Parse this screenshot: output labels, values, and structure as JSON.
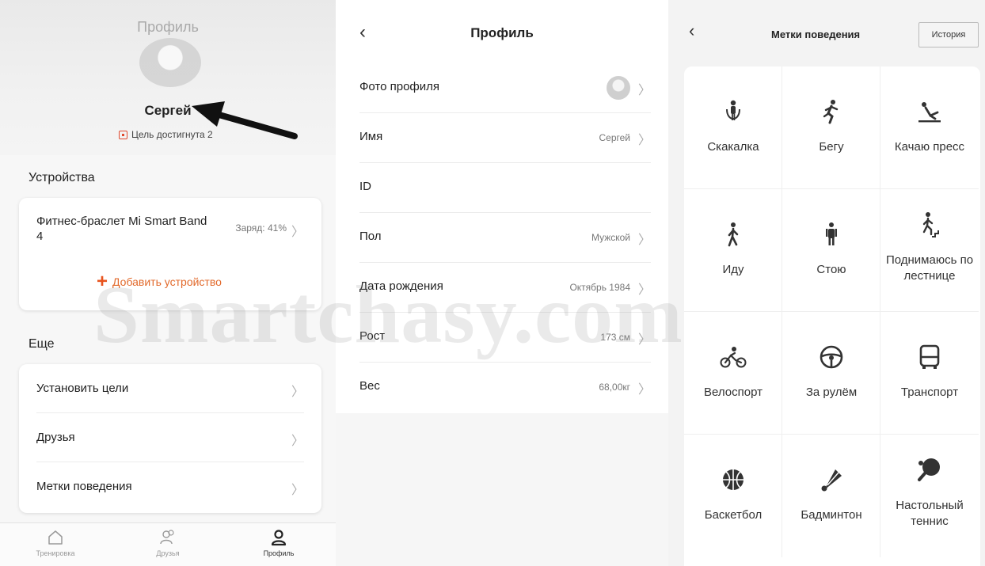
{
  "left": {
    "header": {
      "title": "Профиль",
      "user_name": "Сергей",
      "goal_text": "Цель достигнута 2"
    },
    "devices": {
      "title": "Устройства",
      "device_name": "Фитнес-браслет Mi Smart Band 4",
      "charge": "Заряд: 41%",
      "add_label": "Добавить устройство"
    },
    "more": {
      "title": "Еще",
      "items": [
        {
          "label": "Установить цели"
        },
        {
          "label": "Друзья"
        },
        {
          "label": "Метки поведения"
        }
      ]
    },
    "tabbar": {
      "items": [
        {
          "label": "Тренировка",
          "icon": "home-icon"
        },
        {
          "label": "Друзья",
          "icon": "friends-icon"
        },
        {
          "label": "Профиль",
          "icon": "profile-icon"
        }
      ]
    }
  },
  "middle": {
    "title": "Профиль",
    "rows": [
      {
        "label": "Фото профиля",
        "value": ""
      },
      {
        "label": "Имя",
        "value": "Сергей"
      },
      {
        "label": "ID",
        "value": ""
      },
      {
        "label": "Пол",
        "value": "Мужской"
      },
      {
        "label": "Дата рождения",
        "value": "Октябрь 1984"
      },
      {
        "label": "Рост",
        "value": "173 см"
      },
      {
        "label": "Вес",
        "value": "68,00кг"
      }
    ]
  },
  "right": {
    "title": "Метки поведения",
    "history_label": "История",
    "activities": [
      {
        "label": "Скакалка",
        "icon": "jump-rope-icon"
      },
      {
        "label": "Бегу",
        "icon": "running-icon"
      },
      {
        "label": "Качаю пресс",
        "icon": "situps-icon"
      },
      {
        "label": "Иду",
        "icon": "walking-icon"
      },
      {
        "label": "Стою",
        "icon": "standing-icon"
      },
      {
        "label": "Поднимаюсь по лестнице",
        "icon": "stairs-icon"
      },
      {
        "label": "Велоспорт",
        "icon": "bicycle-icon"
      },
      {
        "label": "За рулём",
        "icon": "steering-wheel-icon"
      },
      {
        "label": "Транспорт",
        "icon": "bus-icon"
      },
      {
        "label": "Баскетбол",
        "icon": "basketball-icon"
      },
      {
        "label": "Бадминтон",
        "icon": "shuttlecock-icon"
      },
      {
        "label": "Настольный теннис",
        "icon": "table-tennis-icon"
      }
    ]
  },
  "watermark": "Smartchasy.com"
}
